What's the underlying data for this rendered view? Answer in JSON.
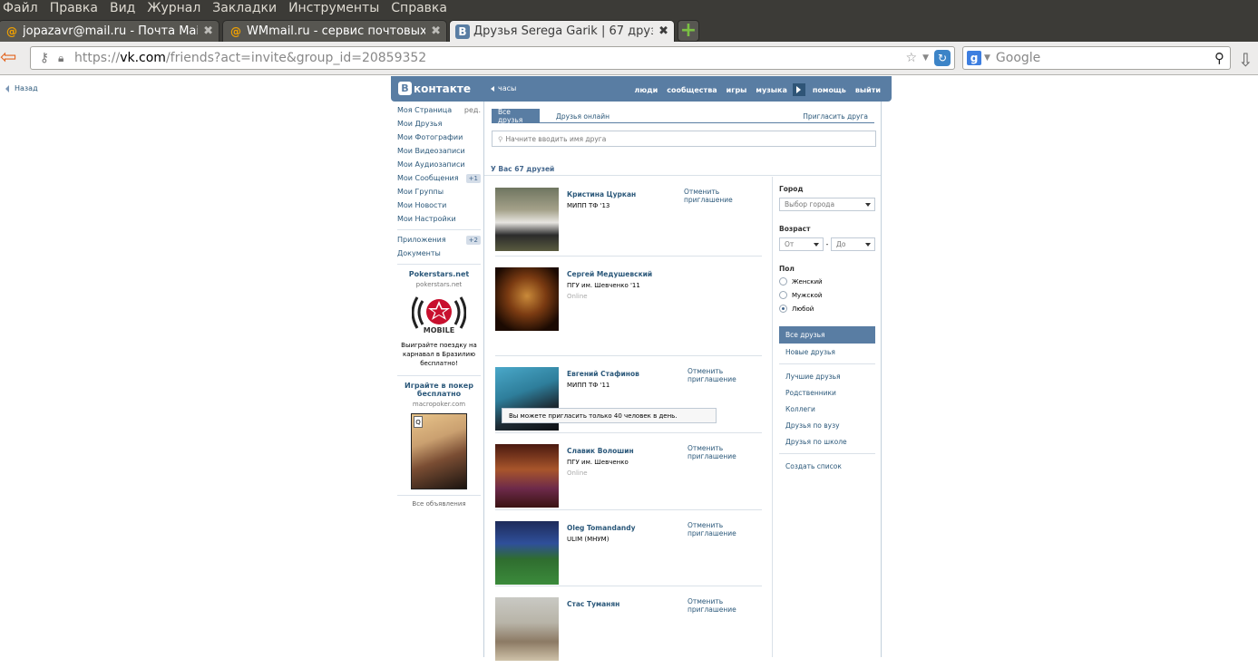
{
  "menubar": [
    "Файл",
    "Правка",
    "Вид",
    "Журнал",
    "Закладки",
    "Инструменты",
    "Справка"
  ],
  "tabs": [
    {
      "label": "jopazavr@mail.ru - Почта Mail.Ru",
      "icon": "@"
    },
    {
      "label": "WMmail.ru - сервис почтовых рассылок",
      "icon": "@"
    },
    {
      "label": "Друзья Serega Garik | 67 друзей",
      "icon": "В"
    }
  ],
  "newtab_label": "+",
  "url": {
    "scheme": "https://",
    "domain": "vk.com",
    "path": "/friends?act=invite&group_id=20859352"
  },
  "search_placeholder": "Google",
  "vk": {
    "back": "Назад",
    "logo": "контакте",
    "logo_b": "В",
    "clock": "часы",
    "nav": [
      "люди",
      "сообщества",
      "игры",
      "музыка",
      "помощь",
      "выйти"
    ],
    "menu": [
      {
        "label": "Моя Страница",
        "extra": "ред."
      },
      {
        "label": "Мои Друзья"
      },
      {
        "label": "Мои Фотографии"
      },
      {
        "label": "Мои Видеозаписи"
      },
      {
        "label": "Мои Аудиозаписи"
      },
      {
        "label": "Мои Сообщения",
        "extra": "+1"
      },
      {
        "label": "Мои Группы"
      },
      {
        "label": "Мои Новости"
      },
      {
        "label": "Мои Настройки"
      }
    ],
    "menu2": [
      {
        "label": "Приложения",
        "extra": "+2"
      },
      {
        "label": "Документы"
      }
    ],
    "ads": [
      {
        "title": "Pokerstars.net",
        "domain": "pokerstars.net",
        "logo_text": "MOBILE",
        "text": "Выиграйте поездку на карнавал в Бразилию бесплатно!"
      },
      {
        "title": "Играйте в покер бесплатно",
        "domain": "macropoker.com"
      }
    ],
    "all_ads": "Все объявления",
    "tab_all": "Все друзья",
    "tab_online": "Друзья онлайн",
    "invite": "Пригласить друга",
    "search_placeholder": "Начните вводить имя друга",
    "count": "У Вас 67 друзей",
    "limit": "Вы можете пригласить только 40 человек в день.",
    "friends": [
      {
        "name": "Кристина Цуркан",
        "uni": "МИПП ТФ '13",
        "online": "",
        "action": "Отменить приглашение"
      },
      {
        "name": "Сергей Медушевский",
        "uni": "ПГУ им. Шевченко '11",
        "online": "Online",
        "action": ""
      },
      {
        "name": "Евгений Стафинов",
        "uni": "МИПП ТФ '11",
        "online": "",
        "action": "Отменить приглашение"
      },
      {
        "name": "Славик Волошин",
        "uni": "ПГУ им. Шевченко",
        "online": "Online",
        "action": "Отменить приглашение"
      },
      {
        "name": "Oleg Tomandandy",
        "uni": "ULIM (МНУМ)",
        "online": "",
        "action": "Отменить приглашение"
      },
      {
        "name": "Стас Туманян",
        "uni": "",
        "online": "",
        "action": "Отменить приглашение"
      }
    ],
    "filters": {
      "city_label": "Город",
      "city_value": "Выбор города",
      "age_label": "Возраст",
      "age_from": "От",
      "age_to": "До",
      "age_dash": "-",
      "sex_label": "Пол",
      "sex_options": [
        "Женский",
        "Мужской",
        "Любой"
      ],
      "sex_selected": 2
    },
    "lists": [
      "Все друзья",
      "Новые друзья"
    ],
    "lists2": [
      "Лучшие друзья",
      "Родственники",
      "Коллеги",
      "Друзья по вузу",
      "Друзья по школе"
    ],
    "create_list": "Создать список"
  },
  "colors": {
    "vk_blue": "#597da3",
    "link": "#2b587a",
    "ubuntu_dark": "#3c3b37"
  }
}
